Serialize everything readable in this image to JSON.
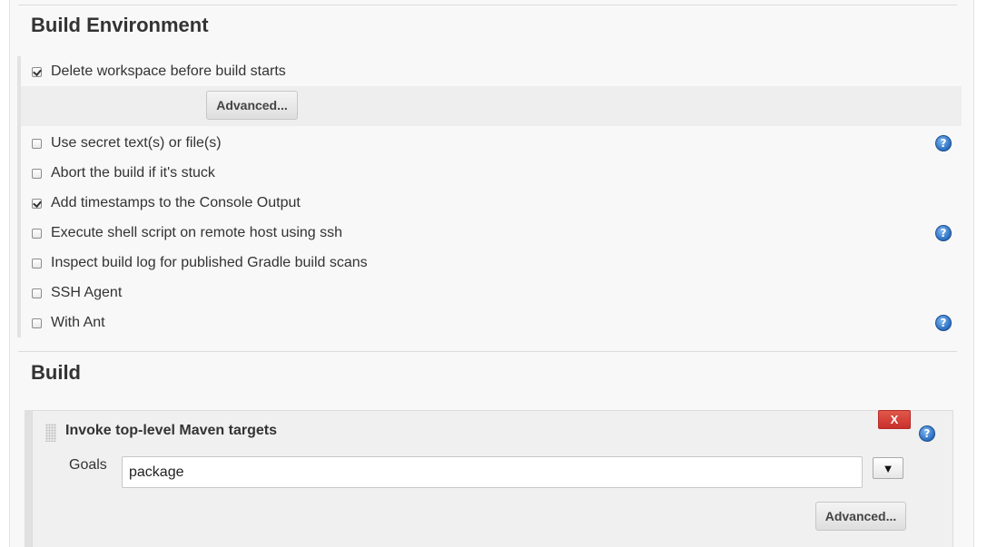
{
  "build_environment": {
    "title": "Build Environment",
    "options": [
      {
        "label": "Delete workspace before build starts",
        "checked": true,
        "help": false
      },
      {
        "label": "Use secret text(s) or file(s)",
        "checked": false,
        "help": true
      },
      {
        "label": "Abort the build if it's stuck",
        "checked": false,
        "help": false
      },
      {
        "label": "Add timestamps to the Console Output",
        "checked": true,
        "help": false
      },
      {
        "label": "Execute shell script on remote host using ssh",
        "checked": false,
        "help": true
      },
      {
        "label": "Inspect build log for published Gradle build scans",
        "checked": false,
        "help": false
      },
      {
        "label": "SSH Agent",
        "checked": false,
        "help": false
      },
      {
        "label": "With Ant",
        "checked": false,
        "help": true
      }
    ],
    "advanced_label": "Advanced..."
  },
  "build": {
    "title": "Build",
    "step": {
      "title": "Invoke top-level Maven targets",
      "delete_label": "X",
      "goals_label": "Goals",
      "goals_value": "package",
      "expand_icon": "▼",
      "advanced_label": "Advanced..."
    }
  },
  "icons": {
    "help": "?"
  },
  "colors": {
    "delete_button": "#c9302c",
    "help_icon": "#2a6dc0"
  }
}
